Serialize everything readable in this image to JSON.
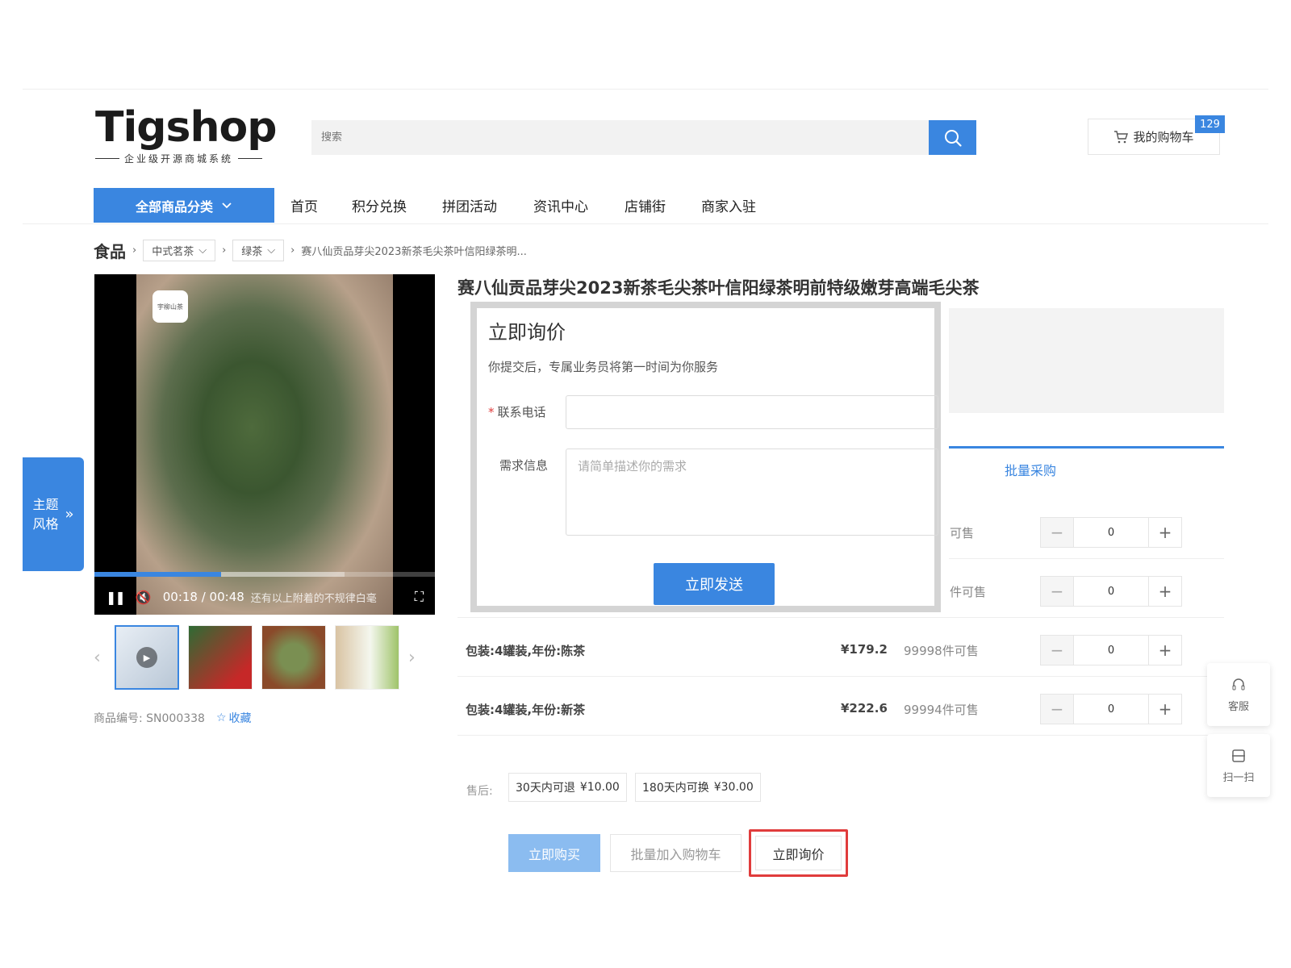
{
  "logo": {
    "word": "Tigshop",
    "tagline": "企业级开源商城系统"
  },
  "search": {
    "placeholder": "搜索"
  },
  "cart": {
    "label": "我的购物车",
    "count": "129"
  },
  "nav": {
    "category_label": "全部商品分类",
    "items": [
      "首页",
      "积分兑换",
      "拼团活动",
      "资讯中心",
      "店铺街",
      "商家入驻"
    ]
  },
  "breadcrumb": {
    "root": "食品",
    "level1": "中式茗茶",
    "level2": "绿茶",
    "current": "赛八仙贡品芽尖2023新茶毛尖茶叶信阳绿茶明..."
  },
  "video": {
    "time": "00:18 / 00:48",
    "subtitle": "还有以上附着的不规律白毫",
    "logo_text": "宇柳山茶"
  },
  "product": {
    "title": "赛八仙贡品芽尖2023新茶毛尖茶叶信阳绿茶明前特级嫩芽高端毛尖茶",
    "sku_label": "商品编号: SN000338",
    "fav_label": "收藏",
    "bulk_tab": "批量采购"
  },
  "variants": [
    {
      "name": "",
      "price": "",
      "stock": "可售",
      "qty": "0"
    },
    {
      "name": "",
      "price": "",
      "stock": "件可售",
      "qty": "0"
    },
    {
      "name": "包装:4罐装,年份:陈茶",
      "price": "¥179.2",
      "stock": "99998件可售",
      "qty": "0"
    },
    {
      "name": "包装:4罐装,年份:新茶",
      "price": "¥222.6",
      "stock": "99994件可售",
      "qty": "0"
    }
  ],
  "after_sale": {
    "label": "售后:",
    "tags": [
      {
        "text": "30天内可退",
        "price": "¥10.00"
      },
      {
        "text": "180天内可换",
        "price": "¥30.00"
      }
    ]
  },
  "actions": {
    "buy": "立即购买",
    "bulk_cart": "批量加入购物车",
    "inquiry": "立即询价"
  },
  "theme_tab": {
    "line1": "主题",
    "line2": "风格"
  },
  "floating": {
    "service": "客服",
    "scan": "扫一扫"
  },
  "modal": {
    "title": "立即询价",
    "desc": "你提交后，专属业务员将第一时间为你服务",
    "phone_label": "联系电话",
    "phone_value": "",
    "need_label": "需求信息",
    "need_placeholder": "请简单描述你的需求",
    "send_label": "立即发送"
  },
  "colors": {
    "accent": "#3a86e0",
    "highlight": "#e03c3c"
  }
}
